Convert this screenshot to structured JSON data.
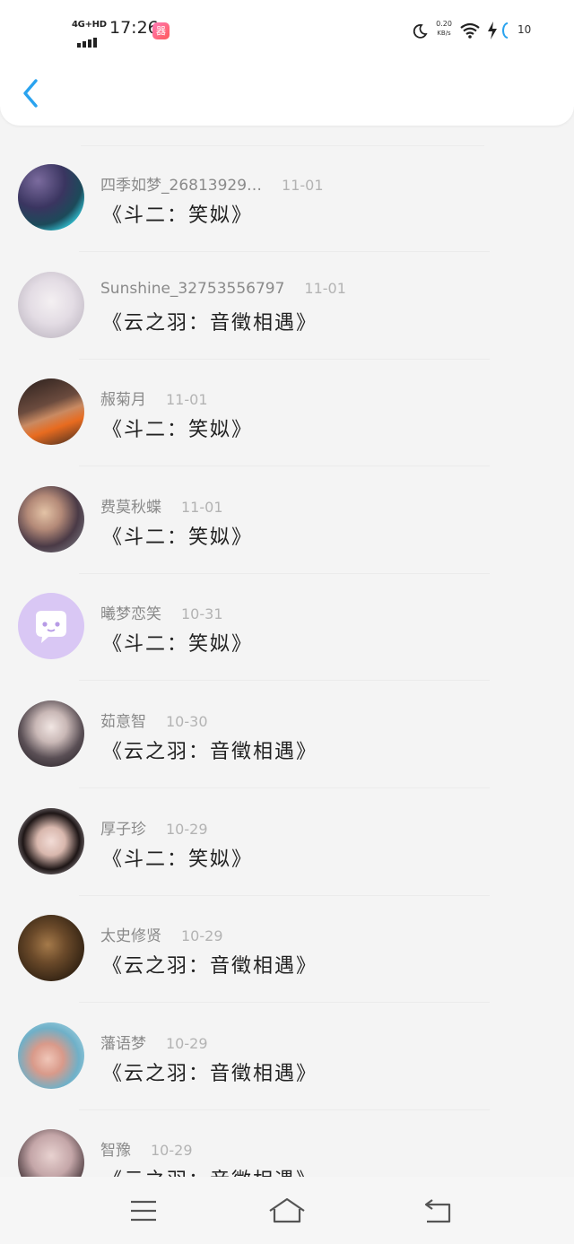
{
  "status_bar": {
    "network": "4G+HD",
    "time": "17:26",
    "app_badge": "器",
    "net_speed_value": "0.20",
    "net_speed_unit": "KB/s",
    "battery_level": "10"
  },
  "header": {
    "back_icon": "chevron-left-icon"
  },
  "colors": {
    "accent": "#2aa3ef",
    "text": "#222222",
    "muted": "#8a8a8a",
    "date": "#b3b3b3"
  },
  "items": [
    {
      "name": "四季如梦_26813929…",
      "date": "11-01",
      "title": "《斗二：笑姒》"
    },
    {
      "name": "Sunshine_32753556797",
      "date": "11-01",
      "title": "《云之羽：音徵相遇》"
    },
    {
      "name": "赧菊月",
      "date": "11-01",
      "title": "《斗二：笑姒》"
    },
    {
      "name": "费莫秋蝶",
      "date": "11-01",
      "title": "《斗二：笑姒》"
    },
    {
      "name": "曦梦恋笑",
      "date": "10-31",
      "title": "《斗二：笑姒》"
    },
    {
      "name": "茹意智",
      "date": "10-30",
      "title": "《云之羽：音徵相遇》"
    },
    {
      "name": "厚子珍",
      "date": "10-29",
      "title": "《斗二：笑姒》"
    },
    {
      "name": "太史修贤",
      "date": "10-29",
      "title": "《云之羽：音徵相遇》"
    },
    {
      "name": "藩语梦",
      "date": "10-29",
      "title": "《云之羽：音徵相遇》"
    },
    {
      "name": "智豫",
      "date": "10-29",
      "title": "《云之羽：音徵相遇》"
    }
  ],
  "navbar": {
    "menu_icon": "menu-icon",
    "home_icon": "home-icon",
    "back_icon": "return-icon"
  }
}
